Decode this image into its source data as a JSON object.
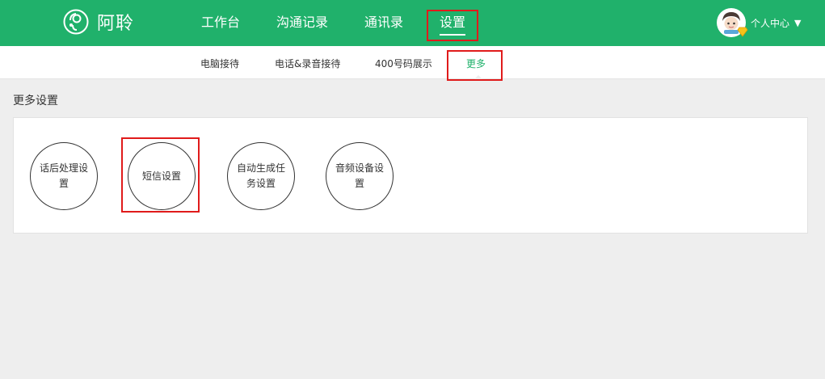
{
  "app": {
    "name": "阿聆",
    "logo_icon": "headset-person-icon"
  },
  "nav": {
    "items": [
      {
        "label": "工作台"
      },
      {
        "label": "沟通记录"
      },
      {
        "label": "通讯录"
      },
      {
        "label": "设置",
        "active": true
      }
    ]
  },
  "user": {
    "label": "个人中心",
    "avatar_icon": "avatar-icon",
    "badge_icon": "diamond-badge-icon",
    "caret_icon": "caret-down-icon"
  },
  "subnav": {
    "items": [
      {
        "label": "电脑接待"
      },
      {
        "label": "电话&录音接待"
      },
      {
        "label": "400号码展示"
      },
      {
        "label": "更多",
        "active": true
      }
    ]
  },
  "section": {
    "title": "更多设置"
  },
  "settings": [
    {
      "label": "话后处理设置"
    },
    {
      "label": "短信设置"
    },
    {
      "label": "自动生成任务设置"
    },
    {
      "label": "音频设备设置"
    }
  ],
  "colors": {
    "brand": "#20b16b",
    "highlight": "#e01b1b",
    "background": "#eeeeee"
  }
}
